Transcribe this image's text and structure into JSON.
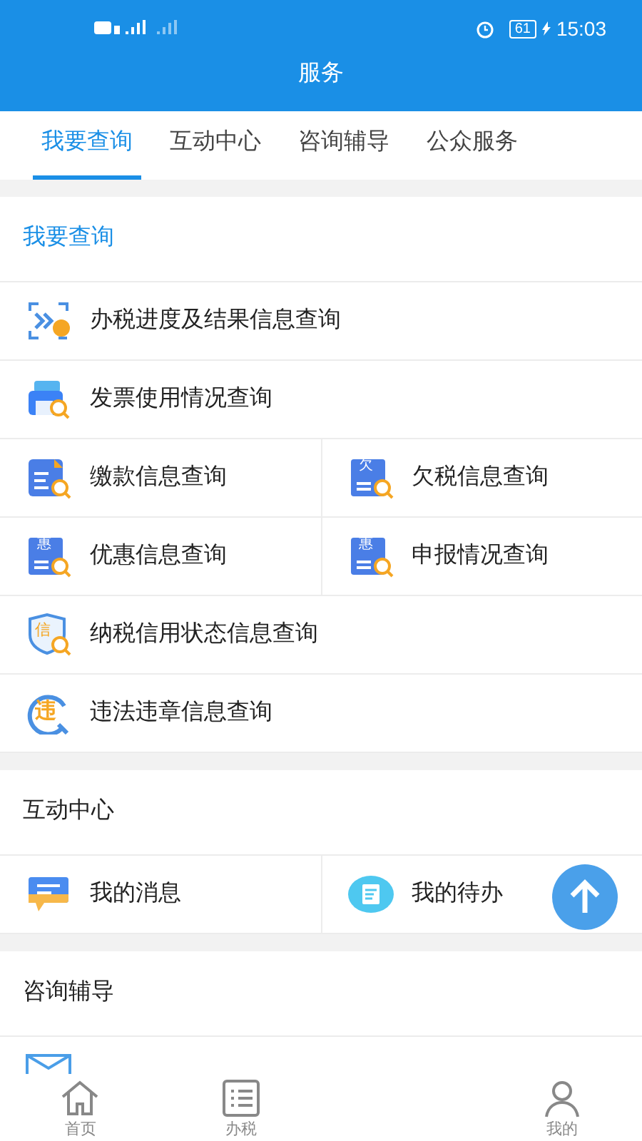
{
  "status_bar": {
    "battery": "61",
    "time": "15:03"
  },
  "header": {
    "title": "服务"
  },
  "tabs": [
    {
      "label": "我要查询",
      "selected": true
    },
    {
      "label": "互动中心",
      "selected": false
    },
    {
      "label": "咨询辅导",
      "selected": false
    },
    {
      "label": "公众服务",
      "selected": false
    }
  ],
  "sections": [
    {
      "title": "我要查询",
      "highlighted": true,
      "rows": [
        [
          {
            "label": "办税进度及结果信息查询",
            "kind": "progress"
          }
        ],
        [
          {
            "label": "发票使用情况查询",
            "kind": "invoice"
          }
        ],
        [
          {
            "label": "缴款信息查询",
            "kind": "payment"
          },
          {
            "label": "欠税信息查询",
            "kind": "doc",
            "glyph": "欠"
          }
        ],
        [
          {
            "label": "优惠信息查询",
            "kind": "doc",
            "glyph": "惠"
          },
          {
            "label": "申报情况查询",
            "kind": "doc",
            "glyph": "惠"
          }
        ],
        [
          {
            "label": "纳税信用状态信息查询",
            "kind": "shield",
            "glyph": "信"
          }
        ],
        [
          {
            "label": "违法违章信息查询",
            "kind": "violation",
            "glyph": "违"
          }
        ]
      ]
    },
    {
      "title": "互动中心",
      "highlighted": false,
      "rows": [
        [
          {
            "label": "我的消息",
            "kind": "message"
          },
          {
            "label": "我的待办",
            "kind": "todo"
          }
        ]
      ]
    },
    {
      "title": "咨询辅导",
      "highlighted": false,
      "partial_row": true
    }
  ],
  "bottom_nav": [
    {
      "label": "首页",
      "kind": "home"
    },
    {
      "label": "办税",
      "kind": "list"
    },
    {
      "label": "我的",
      "kind": "user"
    }
  ]
}
